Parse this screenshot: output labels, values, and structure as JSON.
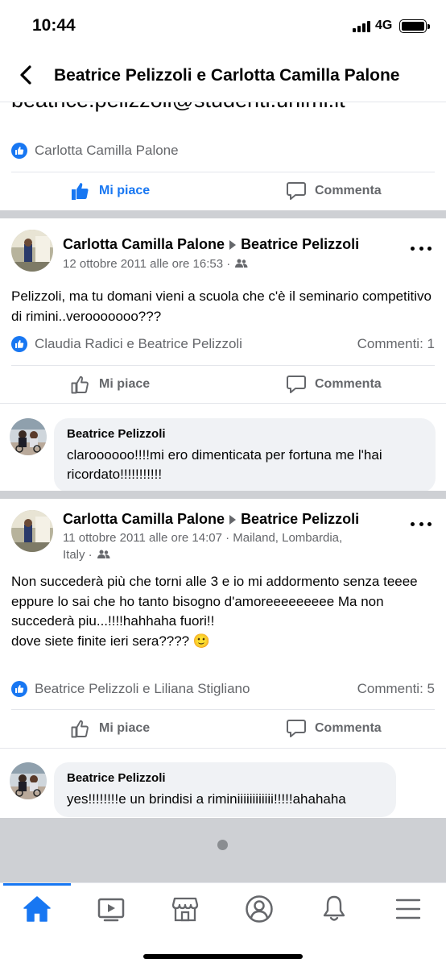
{
  "status": {
    "time": "10:44",
    "network": "4G"
  },
  "header": {
    "title": "Beatrice Pelizzoli e Carlotta Camilla Palone"
  },
  "top_post": {
    "email_fragment": "beatrice.pelizzoli@studenti.unimi.it",
    "reactions": "Carlotta Camilla Palone",
    "like_label": "Mi piace",
    "comment_label": "Commenta"
  },
  "posts": [
    {
      "author": "Carlotta Camilla Palone",
      "target": "Beatrice Pelizzoli",
      "meta_line1": "12 ottobre 2011 alle ore 16:53 ·",
      "meta_line2": "",
      "text": "Pelizzoli, ma tu domani vieni a scuola che c'è il seminario competitivo di rimini..verooooooo???",
      "reactions": "Claudia Radici e Beatrice Pelizzoli",
      "comments_count": "Commenti: 1",
      "like_label": "Mi piace",
      "comment_label": "Commenta",
      "comment": {
        "author": "Beatrice Pelizzoli",
        "text": "claroooooo!!!!mi ero dimenticata per fortuna me l'hai ricordato!!!!!!!!!!!"
      }
    },
    {
      "author": "Carlotta Camilla Palone",
      "target": "Beatrice Pelizzoli",
      "meta_line1": "11 ottobre 2011 alle ore 14:07 · Mailand, Lombardia,",
      "meta_line2": "Italy ·",
      "text_lines": [
        "Non succederà più che torni alle 3 e io mi addormento senza teeee",
        "eppure lo sai che ho tanto bisogno d'amoreeeeeeeee Ma non succederà piu...!!!!hahhaha fuori!!",
        "dove siete finite ieri sera???? 🙂"
      ],
      "reactions": "Beatrice Pelizzoli e Liliana Stigliano",
      "comments_count": "Commenti: 5",
      "like_label": "Mi piace",
      "comment_label": "Commenta",
      "comment": {
        "author": "Beatrice Pelizzoli",
        "text": "yes!!!!!!!!e un brindisi a riminiiiiiiiiiiii!!!!!ahahaha"
      }
    }
  ],
  "colors": {
    "accent": "#1877f2",
    "secondary_text": "#65676b",
    "separator": "#ced0d4"
  },
  "tabs": [
    "home-icon",
    "video-icon",
    "marketplace-icon",
    "profile-icon",
    "notifications-icon",
    "menu-icon"
  ]
}
